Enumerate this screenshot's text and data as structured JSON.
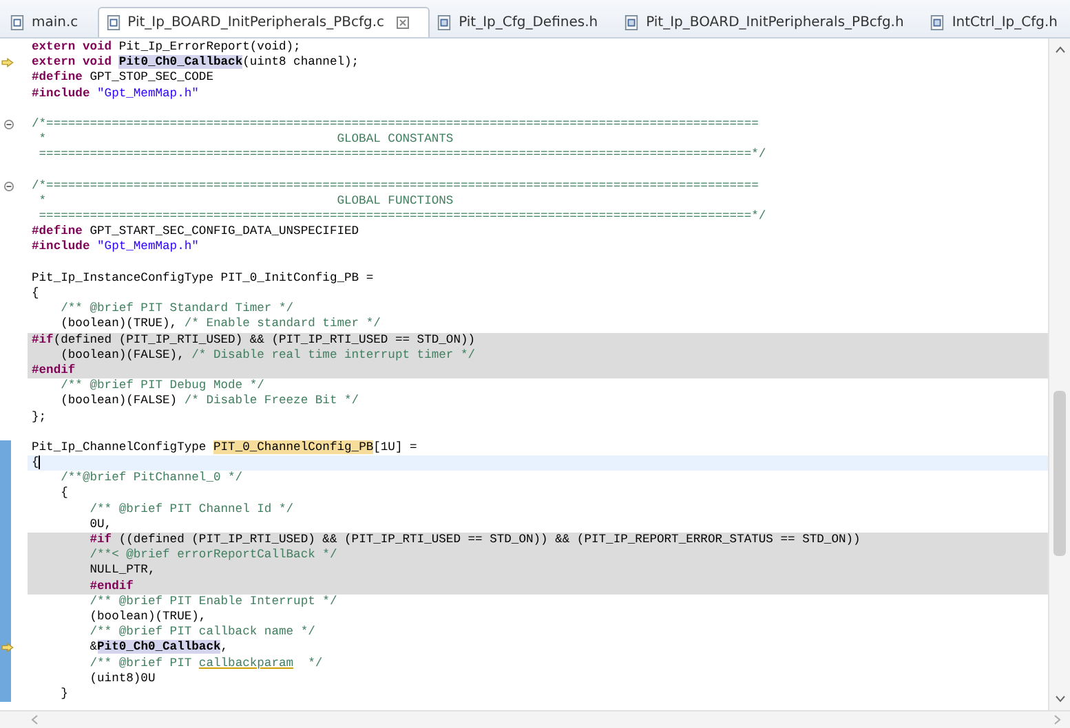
{
  "tabs": [
    {
      "label": "main.c",
      "kind": "source",
      "selected": false
    },
    {
      "label": "Pit_Ip_BOARD_InitPeripherals_PBcfg.c",
      "kind": "source",
      "selected": true
    },
    {
      "label": "Pit_Ip_Cfg_Defines.h",
      "kind": "header",
      "selected": false
    },
    {
      "label": "Pit_Ip_BOARD_InitPeripherals_PBcfg.h",
      "kind": "header",
      "selected": false
    },
    {
      "label": "IntCtrl_Ip_Cfg.h",
      "kind": "header",
      "selected": false
    }
  ],
  "lines": [
    {
      "kind": "code",
      "segments": [
        {
          "kind": "keyword",
          "t": "extern void "
        },
        {
          "kind": "code",
          "t": "Pit_Ip_ErrorReport(void);"
        }
      ]
    },
    {
      "kind": "code",
      "annotation": true,
      "segments": [
        {
          "kind": "keyword",
          "t": "extern void "
        },
        {
          "kind": "occurrence",
          "t": "Pit0_Ch0_Callback"
        },
        {
          "kind": "code",
          "t": "(uint8 channel);"
        }
      ]
    },
    {
      "kind": "code",
      "segments": [
        {
          "kind": "keyword",
          "t": "#define"
        },
        {
          "kind": "code",
          "t": " GPT_STOP_SEC_CODE"
        }
      ]
    },
    {
      "kind": "code",
      "segments": [
        {
          "kind": "keyword",
          "t": "#include"
        },
        {
          "kind": "string",
          "t": " \"Gpt_MemMap.h\""
        }
      ]
    },
    {
      "kind": "blank"
    },
    {
      "kind": "code",
      "fold": true,
      "segments": [
        {
          "kind": "comment",
          "t": "/*=================================================================================================="
        }
      ]
    },
    {
      "kind": "code",
      "segments": [
        {
          "kind": "comment",
          "t": " *                                        GLOBAL CONSTANTS"
        }
      ]
    },
    {
      "kind": "code",
      "segments": [
        {
          "kind": "comment",
          "t": " ==================================================================================================*/"
        }
      ]
    },
    {
      "kind": "blank"
    },
    {
      "kind": "code",
      "fold": true,
      "segments": [
        {
          "kind": "comment",
          "t": "/*=================================================================================================="
        }
      ]
    },
    {
      "kind": "code",
      "segments": [
        {
          "kind": "comment",
          "t": " *                                        GLOBAL FUNCTIONS"
        }
      ]
    },
    {
      "kind": "code",
      "segments": [
        {
          "kind": "comment",
          "t": " ==================================================================================================*/"
        }
      ]
    },
    {
      "kind": "code",
      "segments": [
        {
          "kind": "keyword",
          "t": "#define"
        },
        {
          "kind": "code",
          "t": " GPT_START_SEC_CONFIG_DATA_UNSPECIFIED"
        }
      ]
    },
    {
      "kind": "code",
      "segments": [
        {
          "kind": "keyword",
          "t": "#include"
        },
        {
          "kind": "string",
          "t": " \"Gpt_MemMap.h\""
        }
      ]
    },
    {
      "kind": "blank"
    },
    {
      "kind": "code",
      "segments": [
        {
          "kind": "code",
          "t": "Pit_Ip_InstanceConfigType PIT_0_InitConfig_PB ="
        }
      ]
    },
    {
      "kind": "code",
      "segments": [
        {
          "kind": "code",
          "t": "{"
        }
      ]
    },
    {
      "kind": "code",
      "segments": [
        {
          "kind": "comment",
          "t": "    /** @brief PIT Standard Timer */"
        }
      ]
    },
    {
      "kind": "code",
      "segments": [
        {
          "kind": "code",
          "t": "    (boolean)(TRUE), "
        },
        {
          "kind": "comment",
          "t": "/* Enable standard timer */"
        }
      ]
    },
    {
      "kind": "code",
      "shaded": true,
      "segments": [
        {
          "kind": "keyword",
          "t": "#if"
        },
        {
          "kind": "code",
          "t": "(defined (PIT_IP_RTI_USED) && (PIT_IP_RTI_USED == STD_ON))"
        }
      ]
    },
    {
      "kind": "code",
      "shaded": true,
      "segments": [
        {
          "kind": "code",
          "t": "    (boolean)(FALSE), "
        },
        {
          "kind": "comment",
          "t": "/* Disable real time interrupt timer */"
        }
      ]
    },
    {
      "kind": "code",
      "shaded": true,
      "segments": [
        {
          "kind": "keyword",
          "t": "#endif"
        }
      ]
    },
    {
      "kind": "code",
      "segments": [
        {
          "kind": "comment",
          "t": "    /** @brief PIT Debug Mode */"
        }
      ]
    },
    {
      "kind": "code",
      "segments": [
        {
          "kind": "code",
          "t": "    (boolean)(FALSE) "
        },
        {
          "kind": "comment",
          "t": "/* Disable Freeze Bit */"
        }
      ]
    },
    {
      "kind": "code",
      "segments": [
        {
          "kind": "code",
          "t": "};"
        }
      ]
    },
    {
      "kind": "blank"
    },
    {
      "kind": "code",
      "changed": true,
      "segments": [
        {
          "kind": "code",
          "t": "Pit_Ip_ChannelConfigType "
        },
        {
          "kind": "search-hit",
          "t": "PIT_0_ChannelConfig_PB"
        },
        {
          "kind": "code",
          "t": "[1U] ="
        }
      ]
    },
    {
      "kind": "code",
      "changed": true,
      "current": true,
      "segments": [
        {
          "kind": "code",
          "t": "{"
        }
      ]
    },
    {
      "kind": "code",
      "changed": true,
      "segments": [
        {
          "kind": "comment",
          "t": "    /**@brief PitChannel_0 */"
        }
      ]
    },
    {
      "kind": "code",
      "changed": true,
      "segments": [
        {
          "kind": "code",
          "t": "    {"
        }
      ]
    },
    {
      "kind": "code",
      "changed": true,
      "segments": [
        {
          "kind": "comment",
          "t": "        /** @brief PIT Channel Id */"
        }
      ]
    },
    {
      "kind": "code",
      "changed": true,
      "segments": [
        {
          "kind": "code",
          "t": "        0U,"
        }
      ]
    },
    {
      "kind": "code",
      "changed": true,
      "shaded": true,
      "segments": [
        {
          "kind": "keyword",
          "t": "        #if"
        },
        {
          "kind": "code",
          "t": " ((defined (PIT_IP_RTI_USED) && (PIT_IP_RTI_USED == STD_ON)) && (PIT_IP_REPORT_ERROR_STATUS == STD_ON))"
        }
      ]
    },
    {
      "kind": "code",
      "changed": true,
      "shaded": true,
      "segments": [
        {
          "kind": "comment",
          "t": "        /**< @brief errorReportCallBack */"
        }
      ]
    },
    {
      "kind": "code",
      "changed": true,
      "shaded": true,
      "segments": [
        {
          "kind": "code",
          "t": "        NULL_PTR,"
        }
      ]
    },
    {
      "kind": "code",
      "changed": true,
      "shaded": true,
      "segments": [
        {
          "kind": "keyword",
          "t": "        #endif"
        }
      ]
    },
    {
      "kind": "code",
      "changed": true,
      "segments": [
        {
          "kind": "comment",
          "t": "        /** @brief PIT Enable Interrupt */"
        }
      ]
    },
    {
      "kind": "code",
      "changed": true,
      "segments": [
        {
          "kind": "code",
          "t": "        (boolean)(TRUE),"
        }
      ]
    },
    {
      "kind": "code",
      "changed": true,
      "segments": [
        {
          "kind": "comment",
          "t": "        /** @brief PIT callback name */"
        }
      ]
    },
    {
      "kind": "code",
      "changed": true,
      "annotation": true,
      "segments": [
        {
          "kind": "code",
          "t": "        &"
        },
        {
          "kind": "occurrence",
          "t": "Pit0_Ch0_Callback"
        },
        {
          "kind": "code",
          "t": ","
        }
      ]
    },
    {
      "kind": "code",
      "changed": true,
      "segments": [
        {
          "kind": "comment",
          "t": "        /** @brief PIT "
        },
        {
          "kind": "misspelled",
          "t": "callbackparam"
        },
        {
          "kind": "comment",
          "t": "  */"
        }
      ]
    },
    {
      "kind": "code",
      "changed": true,
      "segments": [
        {
          "kind": "code",
          "t": "        (uint8)0U"
        }
      ]
    },
    {
      "kind": "code",
      "changed": true,
      "segments": [
        {
          "kind": "code",
          "t": "    }"
        }
      ]
    }
  ]
}
